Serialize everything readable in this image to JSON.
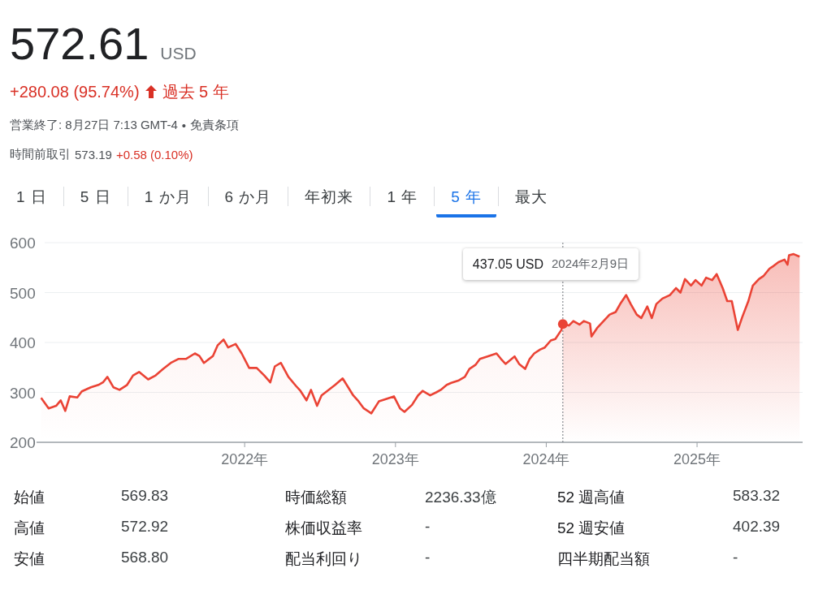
{
  "quote": {
    "price": "572.61",
    "currency": "USD",
    "change": "+280.08 (95.74%)",
    "period": "過去 5 年",
    "status": "営業終了: 8月27日 7:13 GMT-4",
    "separator": "•",
    "disclaimer": "免責条項",
    "premarket_label": "時間前取引",
    "premarket_price": "573.19",
    "premarket_change": "+0.58 (0.10%)"
  },
  "tabs": [
    {
      "label": "1 日",
      "selected": false
    },
    {
      "label": "5 日",
      "selected": false
    },
    {
      "label": "1 か月",
      "selected": false
    },
    {
      "label": "6 か月",
      "selected": false
    },
    {
      "label": "年初来",
      "selected": false
    },
    {
      "label": "1 年",
      "selected": false
    },
    {
      "label": "5 年",
      "selected": true
    },
    {
      "label": "最大",
      "selected": false
    }
  ],
  "chart": {
    "chart_data": {
      "type": "area",
      "x": [
        2020.65,
        2020.7,
        2020.75,
        2020.78,
        2020.81,
        2020.84,
        2020.89,
        2020.92,
        2020.98,
        2021.03,
        2021.06,
        2021.09,
        2021.13,
        2021.17,
        2021.22,
        2021.26,
        2021.3,
        2021.36,
        2021.41,
        2021.46,
        2021.51,
        2021.56,
        2021.61,
        2021.67,
        2021.7,
        2021.73,
        2021.79,
        2021.82,
        2021.86,
        2021.89,
        2021.94,
        2021.98,
        2022.03,
        2022.08,
        2022.13,
        2022.17,
        2022.2,
        2022.24,
        2022.29,
        2022.34,
        2022.37,
        2022.41,
        2022.44,
        2022.48,
        2022.51,
        2022.6,
        2022.65,
        2022.72,
        2022.75,
        2022.79,
        2022.84,
        2022.89,
        2022.92,
        2022.99,
        2023.03,
        2023.06,
        2023.11,
        2023.15,
        2023.18,
        2023.23,
        2023.27,
        2023.3,
        2023.34,
        2023.37,
        2023.42,
        2023.46,
        2023.49,
        2023.53,
        2023.56,
        2023.61,
        2023.67,
        2023.7,
        2023.73,
        2023.79,
        2023.82,
        2023.86,
        2023.89,
        2023.92,
        2023.96,
        2023.99,
        2024.03,
        2024.06,
        2024.1,
        2024.11,
        2024.15,
        2024.18,
        2024.22,
        2024.25,
        2024.29,
        2024.3,
        2024.34,
        2024.39,
        2024.42,
        2024.46,
        2024.49,
        2024.53,
        2024.56,
        2024.6,
        2024.63,
        2024.67,
        2024.7,
        2024.73,
        2024.77,
        2024.82,
        2024.86,
        2024.89,
        2024.92,
        2024.96,
        2024.99,
        2025.03,
        2025.06,
        2025.1,
        2025.13,
        2025.17,
        2025.2,
        2025.23,
        2025.27,
        2025.3,
        2025.34,
        2025.37,
        2025.41,
        2025.44,
        2025.48,
        2025.51,
        2025.54,
        2025.58,
        2025.6,
        2025.61,
        2025.64,
        2025.68
      ],
      "series": [
        {
          "color": "#ea4335",
          "values": [
            289,
            268,
            273,
            284,
            263,
            292,
            290,
            302,
            310,
            315,
            320,
            331,
            310,
            305,
            315,
            334,
            341,
            326,
            334,
            347,
            359,
            367,
            367,
            378,
            373,
            359,
            373,
            394,
            406,
            390,
            397,
            378,
            349,
            349,
            334,
            320,
            352,
            359,
            331,
            313,
            303,
            284,
            305,
            273,
            294,
            315,
            328,
            294,
            284,
            268,
            258,
            282,
            285,
            292,
            268,
            261,
            275,
            294,
            303,
            294,
            300,
            305,
            315,
            319,
            324,
            331,
            347,
            355,
            367,
            372,
            378,
            367,
            357,
            372,
            357,
            347,
            367,
            378,
            386,
            390,
            404,
            407,
            425,
            437,
            434,
            443,
            436,
            443,
            438,
            412,
            430,
            446,
            456,
            461,
            477,
            495,
            477,
            456,
            449,
            472,
            449,
            477,
            488,
            495,
            509,
            500,
            527,
            514,
            525,
            514,
            530,
            525,
            537,
            509,
            483,
            483,
            425,
            451,
            483,
            514,
            527,
            533,
            548,
            554,
            561,
            566,
            556,
            575,
            577,
            572
          ]
        }
      ],
      "xlim": [
        2020.62,
        2025.7
      ],
      "ylim": [
        200,
        600
      ],
      "yticks": [
        200,
        300,
        400,
        500,
        600
      ],
      "xticks": [
        {
          "value": 2022,
          "label": "2022年"
        },
        {
          "value": 2023,
          "label": "2023年"
        },
        {
          "value": 2024,
          "label": "2024年"
        },
        {
          "value": 2025,
          "label": "2025年"
        }
      ],
      "grid": true,
      "ref_lines": [
        {
          "axis": "x",
          "value": 2024.11
        }
      ]
    },
    "tooltip": {
      "value": "437.05 USD",
      "date": "2024年2月9日"
    }
  },
  "stats": [
    {
      "label": "始値",
      "value": "569.83"
    },
    {
      "label": "時価総額",
      "value": "2236.33億"
    },
    {
      "label": "52 週高値",
      "value": "583.32"
    },
    {
      "label": "高値",
      "value": "572.92"
    },
    {
      "label": "株価収益率",
      "value": "-"
    },
    {
      "label": "52 週安値",
      "value": "402.39"
    },
    {
      "label": "安値",
      "value": "568.80"
    },
    {
      "label": "配当利回り",
      "value": "-"
    },
    {
      "label": "四半期配当額",
      "value": "-"
    }
  ]
}
